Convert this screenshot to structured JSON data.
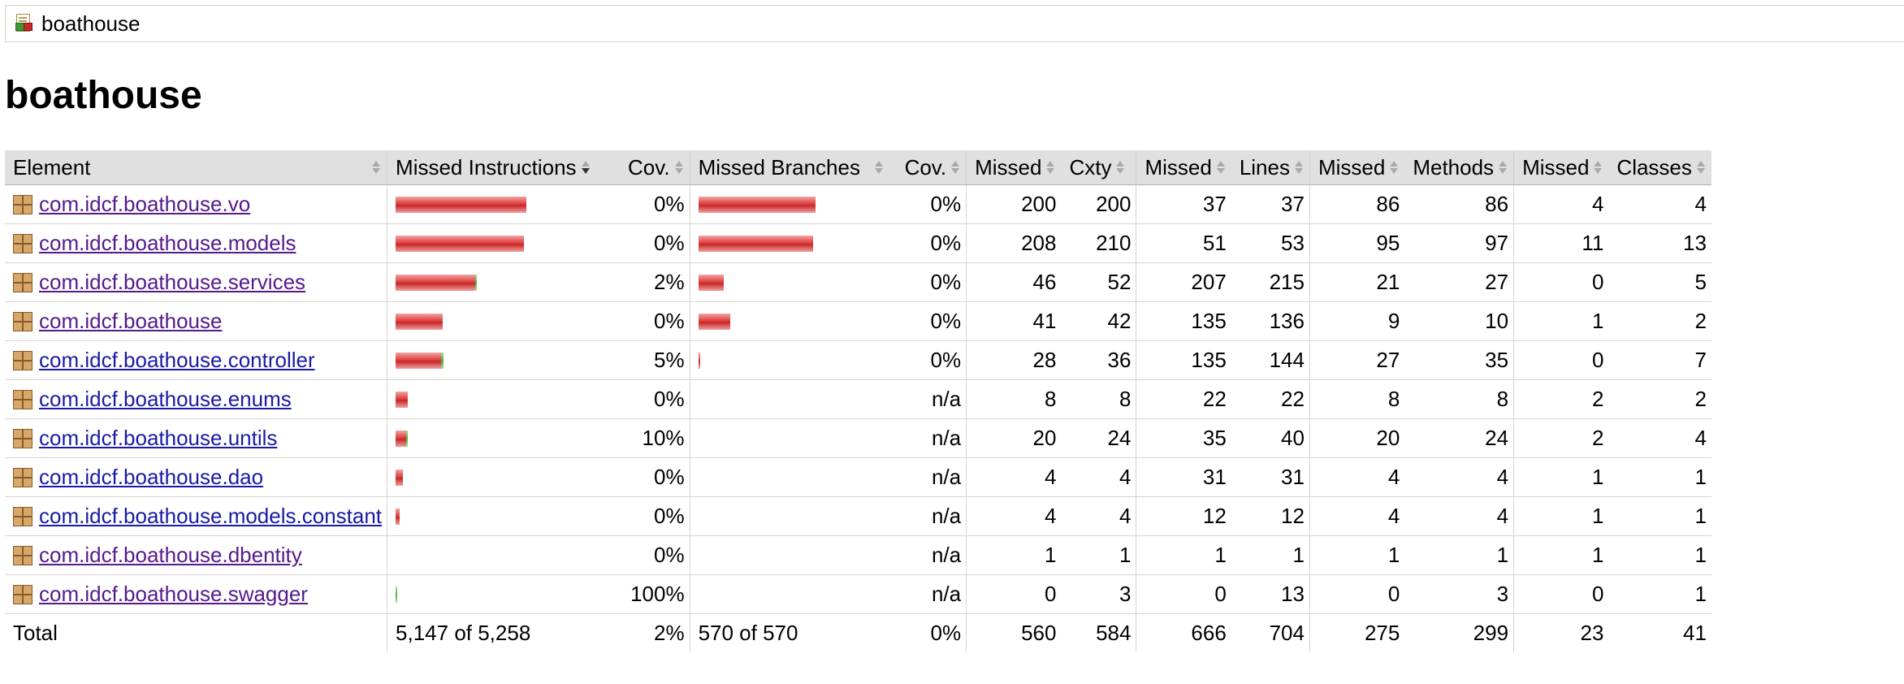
{
  "breadcrumb": {
    "label": "boathouse",
    "icon": "report-icon"
  },
  "page_title": "boathouse",
  "table": {
    "headers": {
      "element": "Element",
      "missed_instructions": "Missed Instructions",
      "cov_instructions": "Cov.",
      "missed_branches": "Missed Branches",
      "cov_branches": "Cov.",
      "missed_cxty": "Missed",
      "cxty": "Cxty",
      "missed_lines": "Missed",
      "lines": "Lines",
      "missed_methods": "Missed",
      "methods": "Methods",
      "missed_classes": "Missed",
      "classes": "Classes"
    },
    "rows": [
      {
        "name": "com.idcf.boathouse.vo",
        "visited": true,
        "instr_missed": 0.6065,
        "instr_covered": 0,
        "instr_cov": "0%",
        "br_missed": 0.6,
        "br_cov": "0%",
        "missed_cxty": "200",
        "cxty": "200",
        "missed_lines": "37",
        "lines": "37",
        "missed_methods": "86",
        "methods": "86",
        "missed_classes": "4",
        "classes": "4"
      },
      {
        "name": "com.idcf.boathouse.models",
        "visited": true,
        "instr_missed": 0.596,
        "instr_covered": 0,
        "instr_cov": "0%",
        "br_missed": 0.59,
        "br_cov": "0%",
        "missed_cxty": "208",
        "cxty": "210",
        "missed_lines": "51",
        "lines": "53",
        "missed_methods": "95",
        "methods": "97",
        "missed_classes": "11",
        "classes": "13"
      },
      {
        "name": "com.idcf.boathouse.services",
        "visited": true,
        "instr_missed": 0.368,
        "instr_covered": 0.008,
        "instr_cov": "2%",
        "br_missed": 0.13,
        "br_cov": "0%",
        "missed_cxty": "46",
        "cxty": "52",
        "missed_lines": "207",
        "lines": "215",
        "missed_methods": "21",
        "methods": "27",
        "missed_classes": "0",
        "classes": "5"
      },
      {
        "name": "com.idcf.boathouse",
        "visited": true,
        "instr_missed": 0.218,
        "instr_covered": 0,
        "instr_cov": "0%",
        "br_missed": 0.165,
        "br_cov": "0%",
        "missed_cxty": "41",
        "cxty": "42",
        "missed_lines": "135",
        "lines": "136",
        "missed_methods": "9",
        "methods": "10",
        "missed_classes": "1",
        "classes": "2"
      },
      {
        "name": "com.idcf.boathouse.controller",
        "visited": false,
        "instr_missed": 0.21,
        "instr_covered": 0.012,
        "instr_cov": "5%",
        "br_missed": 0.008,
        "br_cov": "0%",
        "missed_cxty": "28",
        "cxty": "36",
        "missed_lines": "135",
        "lines": "144",
        "missed_methods": "27",
        "methods": "35",
        "missed_classes": "0",
        "classes": "7"
      },
      {
        "name": "com.idcf.boathouse.enums",
        "visited": false,
        "instr_missed": 0.058,
        "instr_covered": 0,
        "instr_cov": "0%",
        "br_missed": 0,
        "br_cov": "n/a",
        "missed_cxty": "8",
        "cxty": "8",
        "missed_lines": "22",
        "lines": "22",
        "missed_methods": "8",
        "methods": "8",
        "missed_classes": "2",
        "classes": "2"
      },
      {
        "name": "com.idcf.boathouse.untils",
        "visited": false,
        "instr_missed": 0.048,
        "instr_covered": 0.005,
        "instr_cov": "10%",
        "br_missed": 0,
        "br_cov": "n/a",
        "missed_cxty": "20",
        "cxty": "24",
        "missed_lines": "35",
        "lines": "40",
        "missed_methods": "20",
        "methods": "24",
        "missed_classes": "2",
        "classes": "4"
      },
      {
        "name": "com.idcf.boathouse.dao",
        "visited": false,
        "instr_missed": 0.032,
        "instr_covered": 0,
        "instr_cov": "0%",
        "br_missed": 0,
        "br_cov": "n/a",
        "missed_cxty": "4",
        "cxty": "4",
        "missed_lines": "31",
        "lines": "31",
        "missed_methods": "4",
        "methods": "4",
        "missed_classes": "1",
        "classes": "1"
      },
      {
        "name": "com.idcf.boathouse.models.constant",
        "visited": false,
        "instr_missed": 0.02,
        "instr_covered": 0,
        "instr_cov": "0%",
        "br_missed": 0,
        "br_cov": "n/a",
        "missed_cxty": "4",
        "cxty": "4",
        "missed_lines": "12",
        "lines": "12",
        "missed_methods": "4",
        "methods": "4",
        "missed_classes": "1",
        "classes": "1"
      },
      {
        "name": "com.idcf.boathouse.dbentity",
        "visited": true,
        "instr_missed": 0,
        "instr_covered": 0,
        "instr_cov": "0%",
        "br_missed": 0,
        "br_cov": "n/a",
        "missed_cxty": "1",
        "cxty": "1",
        "missed_lines": "1",
        "lines": "1",
        "missed_methods": "1",
        "methods": "1",
        "missed_classes": "1",
        "classes": "1"
      },
      {
        "name": "com.idcf.boathouse.swagger",
        "visited": true,
        "instr_missed": 0,
        "instr_covered": 0.009,
        "instr_cov": "100%",
        "br_missed": 0,
        "br_cov": "n/a",
        "missed_cxty": "0",
        "cxty": "3",
        "missed_lines": "0",
        "lines": "13",
        "missed_methods": "0",
        "methods": "3",
        "missed_classes": "0",
        "classes": "1"
      }
    ],
    "total": {
      "label": "Total",
      "instr": "5,147 of 5,258",
      "instr_cov": "2%",
      "br": "570 of 570",
      "br_cov": "0%",
      "missed_cxty": "560",
      "cxty": "584",
      "missed_lines": "666",
      "lines": "704",
      "missed_methods": "275",
      "methods": "299",
      "missed_classes": "23",
      "classes": "41"
    }
  }
}
